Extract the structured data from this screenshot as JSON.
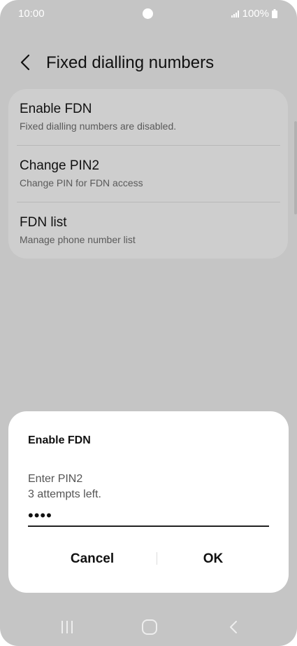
{
  "status_bar": {
    "time": "10:00",
    "battery": "100%"
  },
  "header": {
    "title": "Fixed dialling numbers"
  },
  "settings": {
    "items": [
      {
        "title": "Enable FDN",
        "subtitle": "Fixed dialling numbers are disabled."
      },
      {
        "title": "Change PIN2",
        "subtitle": "Change PIN for FDN access"
      },
      {
        "title": "FDN list",
        "subtitle": "Manage phone number list"
      }
    ]
  },
  "dialog": {
    "title": "Enable FDN",
    "prompt": "Enter PIN2",
    "attempts": "3 attempts left.",
    "pin_value": "••••",
    "cancel_label": "Cancel",
    "ok_label": "OK"
  },
  "icons": {
    "back": "back-arrow-icon",
    "signal": "signal-icon",
    "battery": "battery-icon",
    "recents": "recent-apps-icon",
    "home": "home-icon",
    "nav_back": "nav-back-icon"
  },
  "colors": {
    "background": "#c5c5c5",
    "card": "#cecece",
    "dialog": "#ffffff"
  }
}
